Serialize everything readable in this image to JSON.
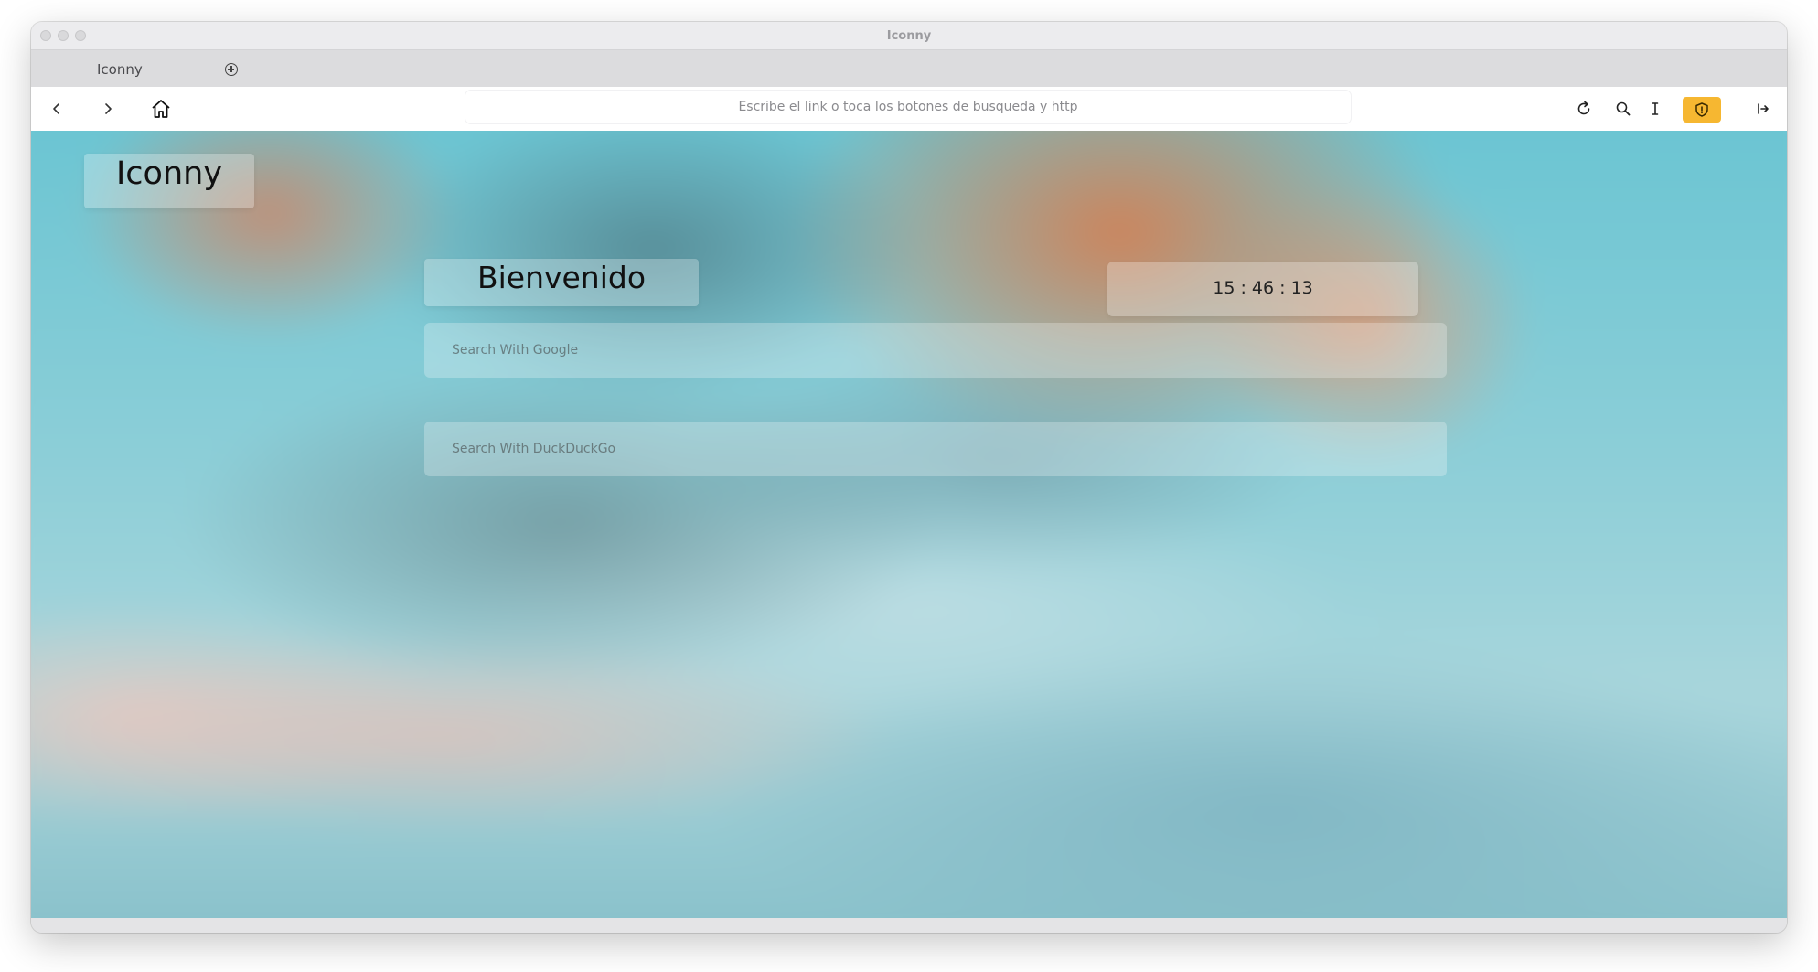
{
  "window": {
    "title": "Iconny"
  },
  "tabs": [
    {
      "label": "Iconny"
    }
  ],
  "toolbar": {
    "address_placeholder": "Escribe el link o toca los botones de busqueda y http",
    "icons": [
      "back-arrow-icon",
      "forward-arrow-icon",
      "home-icon",
      "reload-icon",
      "search-icon",
      "text-cursor-icon",
      "shield-icon",
      "sidebar-toggle-icon"
    ],
    "shield_color": "#f6b731"
  },
  "page": {
    "logo_text": "Iconny",
    "welcome_text": "Bienvenido",
    "clock_text": "15 : 46 : 13",
    "google_placeholder": "Search With Google",
    "duckduckgo_placeholder": "Search With DuckDuckGo"
  }
}
